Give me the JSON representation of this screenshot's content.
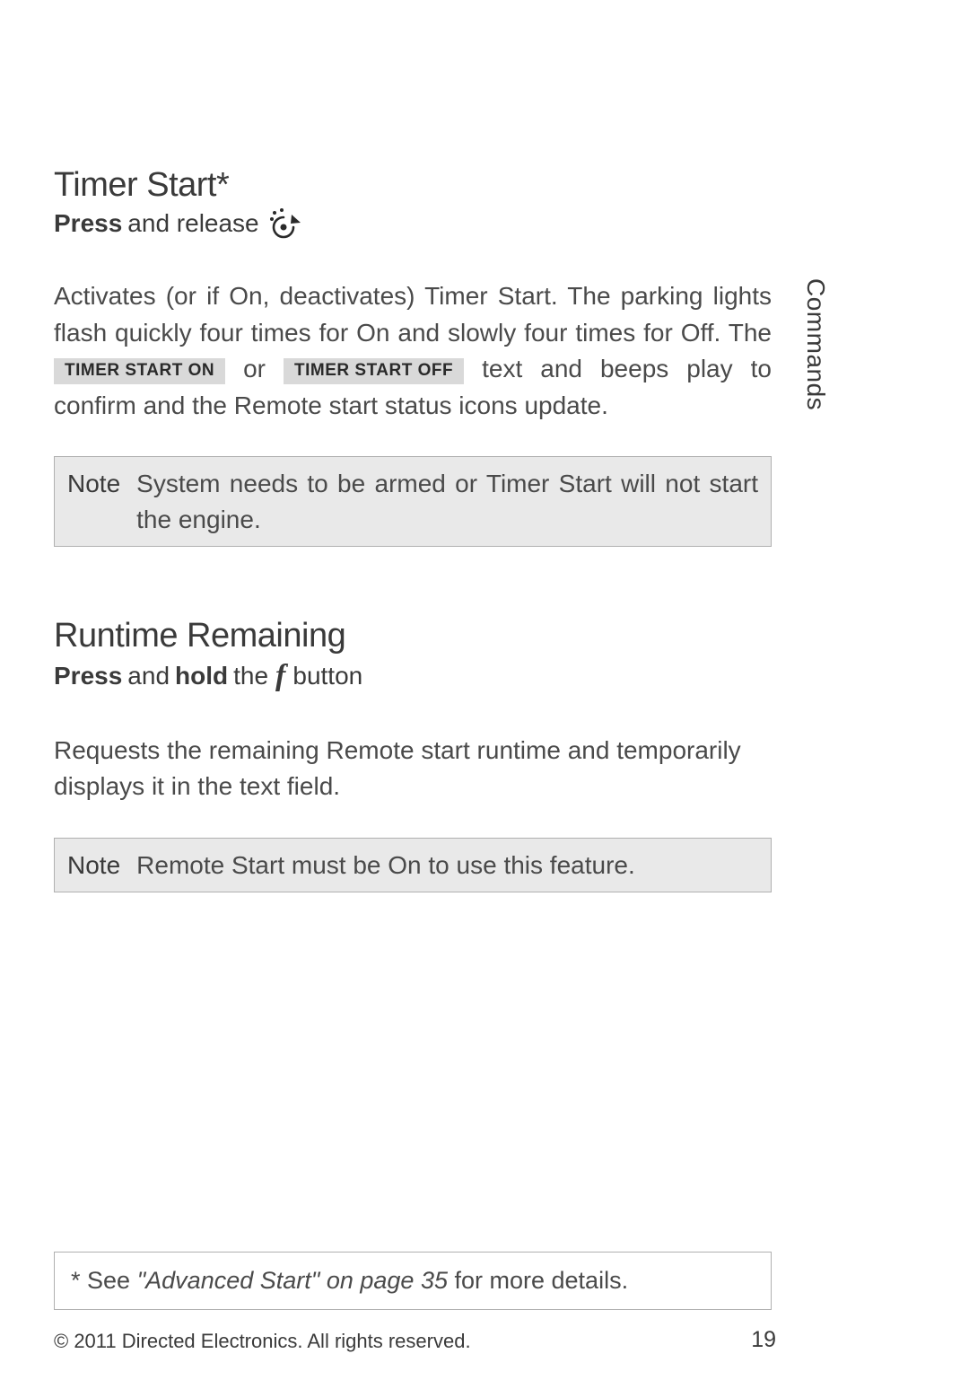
{
  "side_tab": "Commands",
  "section1": {
    "heading": "Timer Start*",
    "instruction_bold1": "Press",
    "instruction_rest": " and release ",
    "para_part1": "Activates (or if On, deactivates) Timer Start. The parking lights flash quickly four times for On and slowly four times for Off. The ",
    "badge_on": "TIMER START ON",
    "mid_or": " or ",
    "badge_off": "TIMER START OFF",
    "para_part2": " text and beeps play to confirm and the Remote start status icons update.",
    "note_label": "Note",
    "note_text": "System needs to be armed or Timer Start will not start the engine."
  },
  "section2": {
    "heading": "Runtime Remaining",
    "instr_b1": "Press",
    "instr_mid1": " and ",
    "instr_b2": "hold",
    "instr_mid2": " the ",
    "f_symbol": "f",
    "instr_end": " button",
    "para": "Requests the remaining Remote start runtime and temporarily displays it in the text field.",
    "note_label": "Note",
    "note_text": "Remote Start must be On to use this feature."
  },
  "footnote": {
    "pre": "* See ",
    "ref": "\"Advanced Start\" on page 35",
    "post": " for more details."
  },
  "copyright": "© 2011 Directed Electronics. All rights reserved.",
  "page_num": "19"
}
